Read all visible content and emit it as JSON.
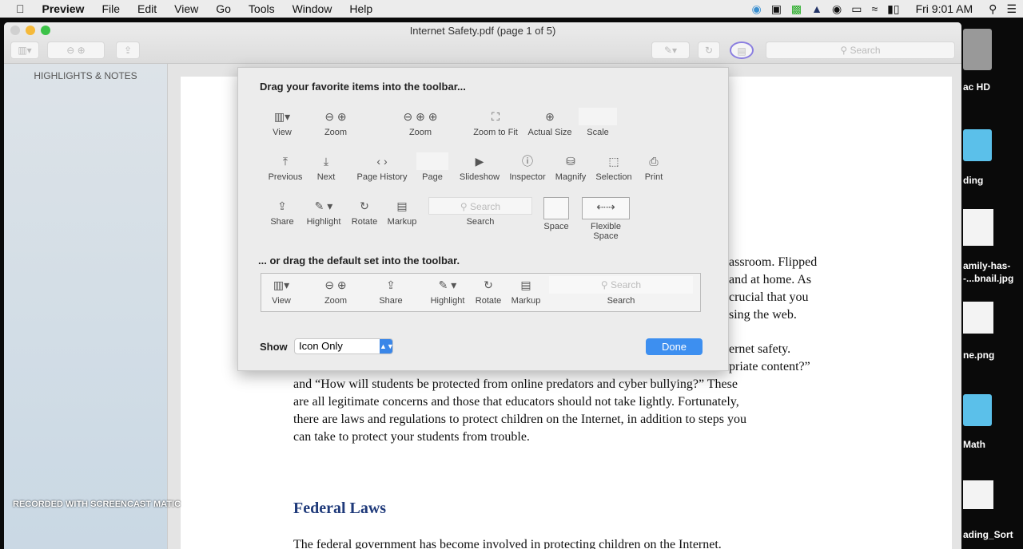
{
  "menubar": {
    "app": "Preview",
    "items": [
      "File",
      "Edit",
      "View",
      "Go",
      "Tools",
      "Window",
      "Help"
    ],
    "clock": "Fri 9:01 AM"
  },
  "window": {
    "title": "Internet Safety.pdf (page 1 of 5)",
    "search_placeholder": "Search"
  },
  "sidebar": {
    "header": "HIGHLIGHTS & NOTES"
  },
  "document": {
    "lines": [
      "assroom. Flipped",
      "and at home. As",
      "crucial that you",
      "sing the web.",
      "ernet safety.",
      "priate content?”",
      "and “How will students be protected from online predators and cyber bullying?” These",
      "are all legitimate concerns and those that educators should not take lightly. Fortunately,",
      "there are laws and regulations to protect children on the Internet, in addition to steps you",
      "can take to protect your students from trouble."
    ],
    "heading": "Federal Laws",
    "last_line": "The federal government has become involved in protecting children on the Internet."
  },
  "sheet": {
    "drag_title": "Drag your favorite items into the toolbar...",
    "items": [
      {
        "icon": "▥▾",
        "label": "View"
      },
      {
        "icon": "⊖ ⊕",
        "label": "Zoom"
      },
      {
        "icon": "⊖ ⊕ ⊕",
        "label": "Zoom"
      },
      {
        "icon": "⛶",
        "label": "Zoom to Fit"
      },
      {
        "icon": "⊕",
        "label": "Actual Size"
      },
      {
        "icon": "",
        "label": "Scale"
      },
      {
        "icon": "⤒",
        "label": "Previous"
      },
      {
        "icon": "⤓",
        "label": "Next"
      },
      {
        "icon": "‹  ›",
        "label": "Page History"
      },
      {
        "icon": "",
        "label": "Page"
      },
      {
        "icon": "▶",
        "label": "Slideshow"
      },
      {
        "icon": "ⓘ",
        "label": "Inspector"
      },
      {
        "icon": "⛁",
        "label": "Magnify"
      },
      {
        "icon": "⬚",
        "label": "Selection"
      },
      {
        "icon": "⎙",
        "label": "Print"
      },
      {
        "icon": "⇪",
        "label": "Share"
      },
      {
        "icon": "✎ ▾",
        "label": "Highlight"
      },
      {
        "icon": "↻",
        "label": "Rotate"
      },
      {
        "icon": "▤",
        "label": "Markup"
      },
      {
        "icon": "",
        "label": "Search"
      },
      {
        "icon": "",
        "label": "Space"
      },
      {
        "icon": "⇠⇢",
        "label": "Flexible Space"
      }
    ],
    "default_title": "... or drag the default set into the toolbar.",
    "default_items": [
      {
        "icon": "▥▾",
        "label": "View"
      },
      {
        "icon": "⊖ ⊕",
        "label": "Zoom"
      },
      {
        "icon": "⇪",
        "label": "Share"
      },
      {
        "icon": "✎ ▾",
        "label": "Highlight"
      },
      {
        "icon": "↻",
        "label": "Rotate"
      },
      {
        "icon": "▤",
        "label": "Markup"
      },
      {
        "icon": "",
        "label": "Search"
      }
    ],
    "search_placeholder": "Search",
    "show_label": "Show",
    "show_value": "Icon Only",
    "done": "Done"
  },
  "desktop": {
    "labels": [
      "ac HD",
      "ding",
      "amily-has-",
      "-...bnail.jpg",
      "ne.png",
      "Math",
      "ading_Sort"
    ]
  },
  "watermark": "RECORDED WITH SCREENCAST MATIC"
}
